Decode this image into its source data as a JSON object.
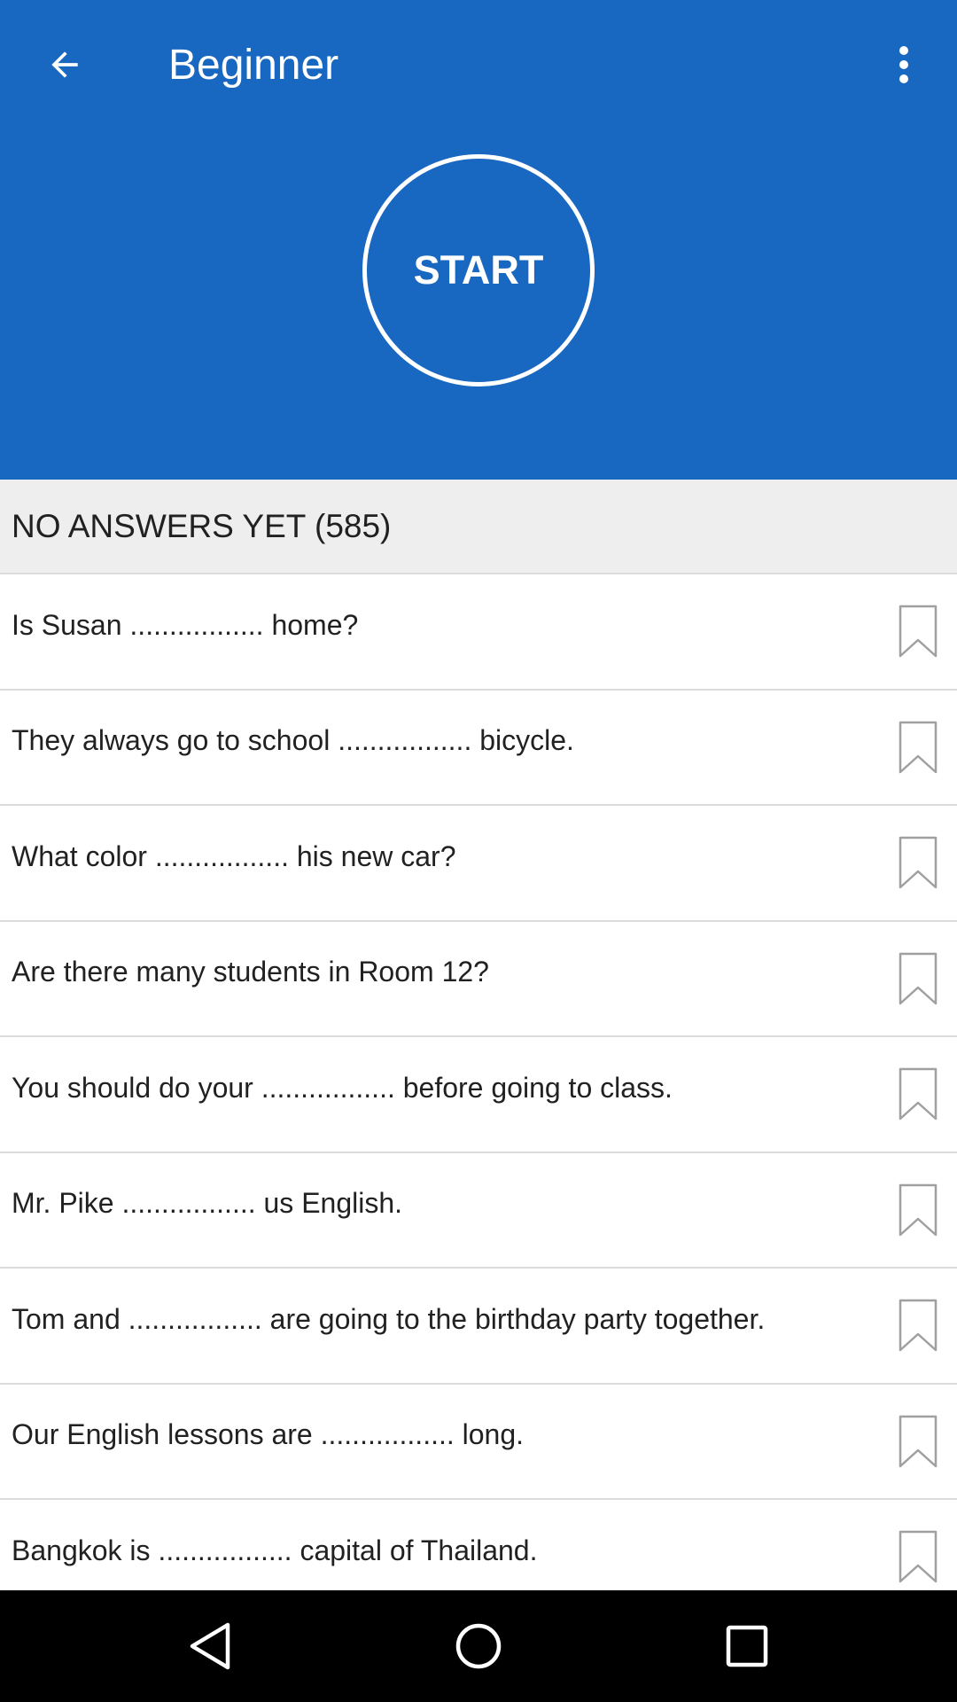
{
  "app_bar": {
    "title": "Beginner",
    "back_icon": "arrow-left-icon",
    "menu_icon": "more-vert-icon",
    "color": "#1867c0"
  },
  "start_button": {
    "label": "START"
  },
  "section": {
    "title": "NO ANSWERS YET (585)"
  },
  "questions": [
    {
      "text": "Is Susan ................. home?"
    },
    {
      "text": "They always go to school ................. bicycle."
    },
    {
      "text": "What color ................. his new car?"
    },
    {
      "text": "Are there many students in Room 12?"
    },
    {
      "text": "You should do your ................. before going to class."
    },
    {
      "text": "Mr. Pike ................. us English."
    },
    {
      "text": "Tom and ................. are going to the birthday party together."
    },
    {
      "text": "Our English lessons are ................. long."
    },
    {
      "text": "Bangkok is ................. capital of Thailand."
    }
  ],
  "bookmark_icon": "bookmark-outline-icon",
  "nav_bar": {
    "back_icon": "nav-back-icon",
    "home_icon": "nav-home-icon",
    "recents_icon": "nav-recents-icon"
  }
}
